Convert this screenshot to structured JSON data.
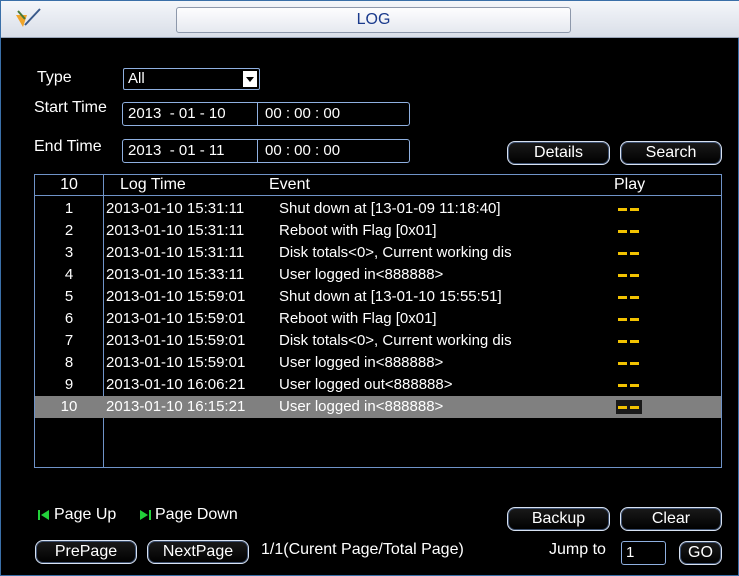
{
  "title": "LOG",
  "filters": {
    "type_label": "Type",
    "type_value": "All",
    "start_label": "Start Time",
    "start_date": "2013  - 01 - 10",
    "start_time": "00 : 00 : 00",
    "end_label": "End Time",
    "end_date": "2013  - 01 - 11",
    "end_time": "00 : 00 : 00"
  },
  "buttons": {
    "details": "Details",
    "search": "Search",
    "backup": "Backup",
    "clear": "Clear",
    "prepage": "PrePage",
    "nextpage": "NextPage",
    "go": "GO"
  },
  "table": {
    "count": "10",
    "headers": {
      "time": "Log Time",
      "event": "Event",
      "play": "Play"
    },
    "rows": [
      {
        "no": "1",
        "time": "2013-01-10 15:31:11",
        "event": "Shut down at [13-01-09 11:18:40]"
      },
      {
        "no": "2",
        "time": "2013-01-10 15:31:11",
        "event": "Reboot with Flag [0x01]"
      },
      {
        "no": "3",
        "time": "2013-01-10 15:31:11",
        "event": "Disk totals<0>, Current working dis"
      },
      {
        "no": "4",
        "time": "2013-01-10 15:33:11",
        "event": "User logged in<888888>"
      },
      {
        "no": "5",
        "time": "2013-01-10 15:59:01",
        "event": "Shut down at [13-01-10 15:55:51]"
      },
      {
        "no": "6",
        "time": "2013-01-10 15:59:01",
        "event": "Reboot with Flag [0x01]"
      },
      {
        "no": "7",
        "time": "2013-01-10 15:59:01",
        "event": "Disk totals<0>, Current working dis"
      },
      {
        "no": "8",
        "time": "2013-01-10 15:59:01",
        "event": "User logged in<888888>"
      },
      {
        "no": "9",
        "time": "2013-01-10 16:06:21",
        "event": "User logged out<888888>"
      },
      {
        "no": "10",
        "time": "2013-01-10 16:15:21",
        "event": "User logged in<888888>"
      }
    ],
    "selected_row": "10"
  },
  "pager": {
    "page_up": "Page Up",
    "page_down": "Page Down",
    "page_info": "1/1(Curent Page/Total Page)",
    "jump_label": "Jump to",
    "jump_value": "1"
  },
  "colors": {
    "accent": "#1a3a8c",
    "border": "#8fb0e0",
    "play_marker": "#f2c200",
    "selection": "#808080",
    "page_nav_icon": "#22d13a"
  }
}
